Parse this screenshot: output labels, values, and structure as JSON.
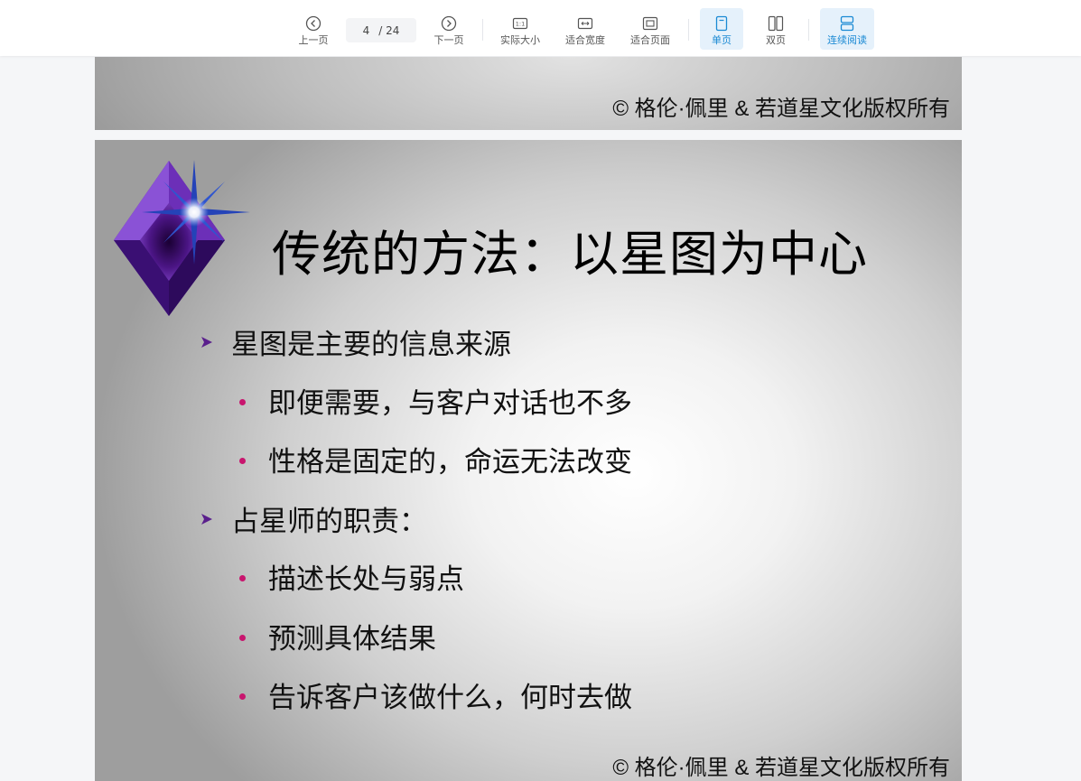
{
  "toolbar": {
    "prev_label": "上一页",
    "current_page": "4",
    "total_pages": "/ 24",
    "next_label": "下一页",
    "actual_size_label": "实际大小",
    "fit_width_label": "适合宽度",
    "fit_page_label": "适合页面",
    "single_page_label": "单页",
    "double_page_label": "双页",
    "continuous_label": "连续阅读",
    "accent_color": "#1b8ad4"
  },
  "slides": {
    "prev_slide": {
      "copyright": "© 格伦·佩里 & 若道星文化版权所有"
    },
    "current_slide": {
      "title": "传统的方法：以星图为中心",
      "bullets": [
        {
          "level": 1,
          "text": "星图是主要的信息来源"
        },
        {
          "level": 2,
          "text": "即便需要，与客户对话也不多"
        },
        {
          "level": 2,
          "text": "性格是固定的，命运无法改变"
        },
        {
          "level": 1,
          "text": "占星师的职责："
        },
        {
          "level": 2,
          "text": "描述长处与弱点"
        },
        {
          "level": 2,
          "text": "预测具体结果"
        },
        {
          "level": 2,
          "text": "告诉客户该做什么，何时去做"
        }
      ],
      "copyright": "© 格伦·佩里 & 若道星文化版权所有",
      "bullet_dot_color": "#c8156e",
      "arrow_color": "#5a1f8c"
    }
  }
}
